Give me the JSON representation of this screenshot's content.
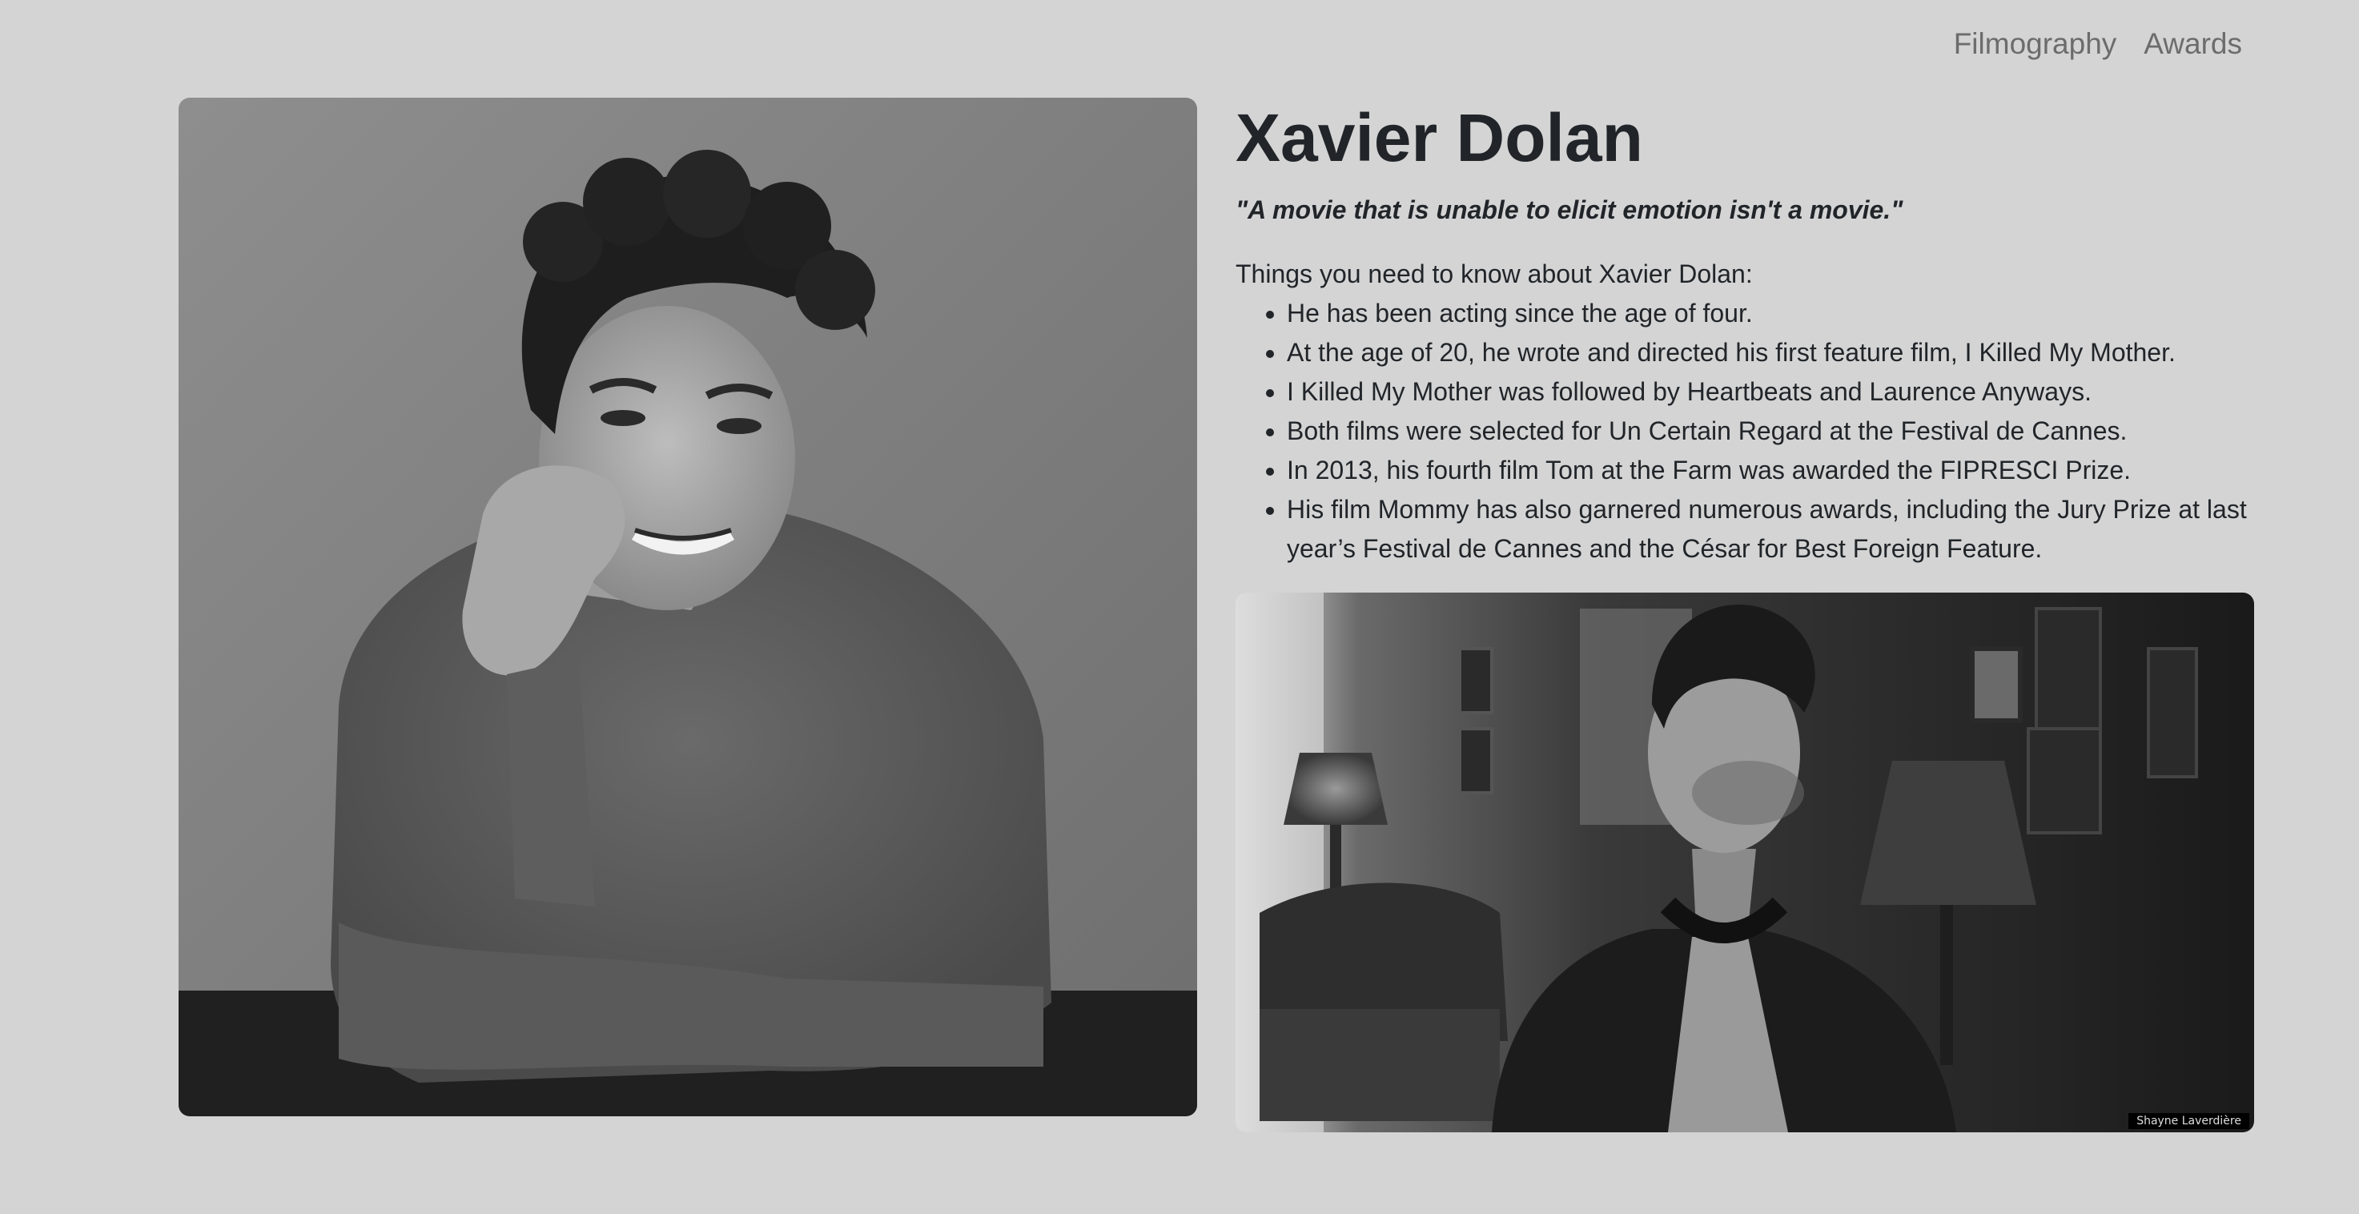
{
  "nav": {
    "items": [
      {
        "label": "Filmography"
      },
      {
        "label": "Awards"
      }
    ]
  },
  "profile": {
    "name": "Xavier Dolan",
    "quote": "\"A movie that is unable to elicit emotion isn't a movie.\"",
    "intro": "Things you need to know about Xavier Dolan:",
    "facts": [
      "He has been acting since the age of four.",
      "At the age of 20, he wrote and directed his first feature film, I Killed My Mother.",
      "I Killed My Mother was followed by Heartbeats and Laurence Anyways.",
      "Both films were selected for Un Certain Regard at the Festival de Cannes.",
      "In 2013, his fourth film Tom at the Farm was awarded the FIPRESCI Prize.",
      "His film Mommy has also garnered numerous awards, including the Jury Prize at last year’s Festival de Cannes and the César for Best Foreign Feature."
    ]
  },
  "photos": {
    "second_credit": "Shayne Laverdière"
  }
}
